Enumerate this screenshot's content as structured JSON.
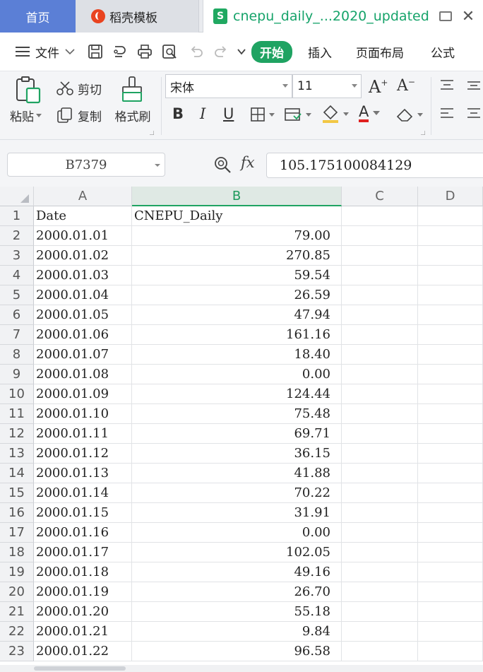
{
  "tabs": {
    "home": "首页",
    "docer": "稻壳模板",
    "file_icon_letter": "S",
    "file": "cnepu_daily_...2020_updated",
    "close": "✕"
  },
  "menu": {
    "file": "文件",
    "start": "开始",
    "insert": "插入",
    "layout": "页面布局",
    "formula": "公式"
  },
  "ribbon": {
    "paste": "粘贴",
    "cut": "剪切",
    "copy": "复制",
    "format_painter": "格式刷",
    "font_name": "宋体",
    "font_size": "11",
    "bold": "B",
    "italic": "I",
    "underline": "U",
    "grow": "A",
    "shrink": "A",
    "font_color": "A"
  },
  "formula_bar": {
    "name_box": "B7379",
    "fx": "fx",
    "value": "105.175100084129"
  },
  "columns": [
    "A",
    "B",
    "C",
    "D"
  ],
  "rows": [
    {
      "n": "1",
      "a": "Date",
      "b": "CNEPU_Daily"
    },
    {
      "n": "2",
      "a": "2000.01.01",
      "b": "79.00"
    },
    {
      "n": "3",
      "a": "2000.01.02",
      "b": "270.85"
    },
    {
      "n": "4",
      "a": "2000.01.03",
      "b": "59.54"
    },
    {
      "n": "5",
      "a": "2000.01.04",
      "b": "26.59"
    },
    {
      "n": "6",
      "a": "2000.01.05",
      "b": "47.94"
    },
    {
      "n": "7",
      "a": "2000.01.06",
      "b": "161.16"
    },
    {
      "n": "8",
      "a": "2000.01.07",
      "b": "18.40"
    },
    {
      "n": "9",
      "a": "2000.01.08",
      "b": "0.00"
    },
    {
      "n": "10",
      "a": "2000.01.09",
      "b": "124.44"
    },
    {
      "n": "11",
      "a": "2000.01.10",
      "b": "75.48"
    },
    {
      "n": "12",
      "a": "2000.01.11",
      "b": "69.71"
    },
    {
      "n": "13",
      "a": "2000.01.12",
      "b": "36.15"
    },
    {
      "n": "14",
      "a": "2000.01.13",
      "b": "41.88"
    },
    {
      "n": "15",
      "a": "2000.01.14",
      "b": "70.22"
    },
    {
      "n": "16",
      "a": "2000.01.15",
      "b": "31.91"
    },
    {
      "n": "17",
      "a": "2000.01.16",
      "b": "0.00"
    },
    {
      "n": "18",
      "a": "2000.01.17",
      "b": "102.05"
    },
    {
      "n": "19",
      "a": "2000.01.18",
      "b": "49.16"
    },
    {
      "n": "20",
      "a": "2000.01.19",
      "b": "26.70"
    },
    {
      "n": "21",
      "a": "2000.01.20",
      "b": "55.18"
    },
    {
      "n": "22",
      "a": "2000.01.21",
      "b": "9.84"
    },
    {
      "n": "23",
      "a": "2000.01.22",
      "b": "96.58"
    }
  ],
  "colors": {
    "accent_green": "#1fa362",
    "home_tab_blue": "#5b7fd6",
    "docer_red": "#e9431f"
  }
}
